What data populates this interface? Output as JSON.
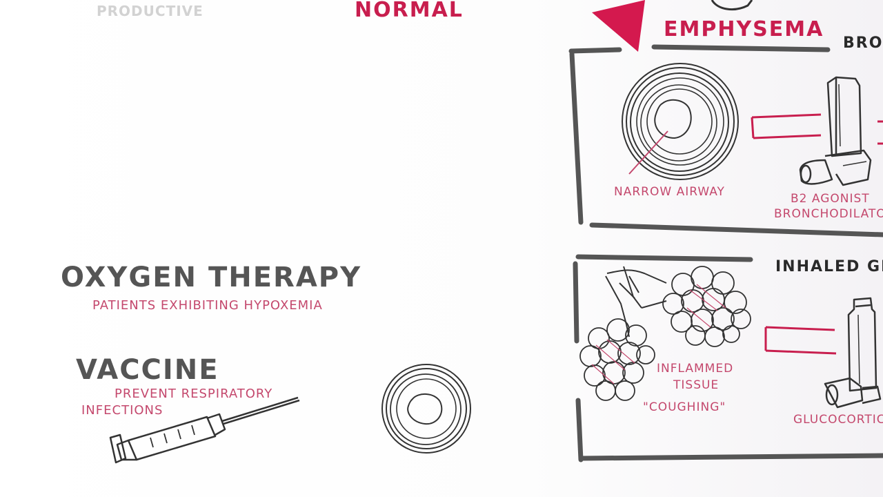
{
  "colors": {
    "ink": "#333333",
    "gray_heading": "#555555",
    "accent_red": "#c81e4e",
    "pink_note": "#c4486d"
  },
  "faded_top_left": "PRODUCTIVE",
  "normal_title": "NORMAL",
  "emphysema_title": "EMPHYSEMA",
  "panel_top": {
    "heading_partial": "BRON",
    "airway_label": "NARROW AIRWAY",
    "inhaler_label_line1": "B2 AGONIST",
    "inhaler_label_line2": "BRONCHODILATOR"
  },
  "panel_bottom": {
    "heading_partial": "INHALED GLU",
    "tissue_label_line1": "INFLAMMED",
    "tissue_label_line2": "TISSUE",
    "tissue_label_line3": "\"COUGHING\"",
    "inhaler_label": "GLUCOCORTICO"
  },
  "oxygen": {
    "title": "OXYGEN THERAPY",
    "note": "PATIENTS EXHIBITING HYPOXEMIA"
  },
  "vaccine": {
    "title": "VACCINE",
    "note_line1": "PREVENT RESPIRATORY",
    "note_line2": "INFECTIONS"
  },
  "icons": {
    "airway_cross_section": "airway-cross-section-icon",
    "inhaler": "inhaler-icon",
    "syringe": "syringe-icon",
    "alveoli": "alveoli-cluster-icon",
    "arrow": "arrow-icon"
  }
}
